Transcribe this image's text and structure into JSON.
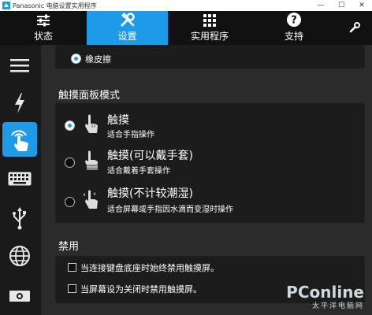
{
  "window": {
    "title": "Panasonic 电脑设置实用程序",
    "minimize": "—",
    "maximize": "☐",
    "close": "✕"
  },
  "topnav": {
    "tabs": [
      {
        "label": "状态",
        "icon": "sliders-icon"
      },
      {
        "label": "设置",
        "icon": "tools-icon",
        "active": true
      },
      {
        "label": "实用程序",
        "icon": "grid-icon"
      },
      {
        "label": "支持",
        "icon": "help-icon"
      }
    ],
    "extra_icon": "wrench-icon"
  },
  "sidebar": {
    "items": [
      {
        "icon": "menu-icon"
      },
      {
        "icon": "power-icon"
      },
      {
        "icon": "touch-icon",
        "active": true
      },
      {
        "icon": "keyboard-icon"
      },
      {
        "icon": "usb-icon"
      },
      {
        "icon": "globe-icon"
      },
      {
        "icon": "camera-icon"
      }
    ]
  },
  "content": {
    "eraser_option": "橡皮擦",
    "touch_mode": {
      "title": "触摸面板模式",
      "options": [
        {
          "title": "触摸",
          "subtitle": "适合手指操作",
          "selected": true
        },
        {
          "title": "触摸(可以戴手套)",
          "subtitle": "适合戴着手套操作",
          "selected": false
        },
        {
          "title": "触摸(不计较潮湿)",
          "subtitle": "适合屏幕或手指因水滴而变湿时操作",
          "selected": false
        }
      ]
    },
    "disable": {
      "title": "禁用",
      "checkboxes": [
        {
          "label": "当连接键盘底座时始终禁用触摸屏。",
          "checked": false
        },
        {
          "label": "当屏幕设为关闭时禁用触摸屏。",
          "checked": false
        }
      ]
    }
  },
  "watermark": {
    "line1": "PConline",
    "line2": "太平洋电脑网"
  },
  "colors": {
    "accent": "#1e9be8",
    "background": "#2b2b2b",
    "card": "#1c1c1c"
  }
}
